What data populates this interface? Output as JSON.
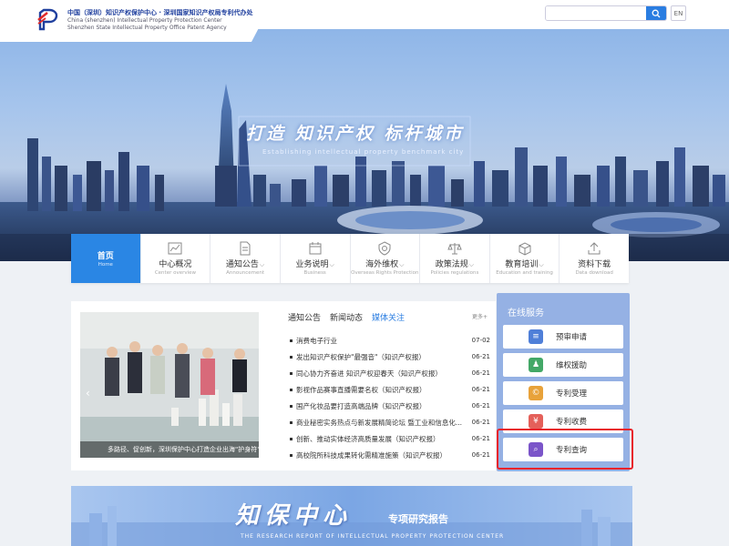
{
  "header": {
    "org_cn": "中国（深圳）知识产权保护中心 · 深圳国家知识产权局专利代办处",
    "org_en_1": "China (shenzhen) Intellectual Property Protection Center",
    "org_en_2": "Shenzhen State Intellectual Property Office Patent Agency",
    "search_placeholder": "",
    "lang_label": "EN"
  },
  "banner": {
    "slogan_cn": "打造 知识产权 标杆城市",
    "slogan_en": "Establishing intellectual property benchmark city"
  },
  "nav": [
    {
      "label": "首页",
      "sub": "Home",
      "icon": "home-icon",
      "active": true,
      "caret": ""
    },
    {
      "label": "中心概况",
      "sub": "Center overview",
      "icon": "chart-icon",
      "active": false,
      "caret": ""
    },
    {
      "label": "通知公告",
      "sub": "Announcement",
      "icon": "document-icon",
      "active": false,
      "caret": "⌵"
    },
    {
      "label": "业务说明",
      "sub": "Business",
      "icon": "calendar-icon",
      "active": false,
      "caret": "⌵"
    },
    {
      "label": "海外维权",
      "sub": "Overseas Rights Protection",
      "icon": "shield-icon",
      "active": false,
      "caret": "⌵"
    },
    {
      "label": "政策法规",
      "sub": "Policies regulations",
      "icon": "scale-icon",
      "active": false,
      "caret": "⌵"
    },
    {
      "label": "教育培训",
      "sub": "Education and training",
      "icon": "box-icon",
      "active": false,
      "caret": "⌵"
    },
    {
      "label": "资料下载",
      "sub": "Data download",
      "icon": "upload-icon",
      "active": false,
      "caret": ""
    }
  ],
  "news": {
    "tabs": [
      "通知公告",
      "新闻动态",
      "媒体关注"
    ],
    "active_tab": 2,
    "more_label": "更多+",
    "photo_caption": "多路径、促创新，深圳保护中心打造企业出海\"护身符\"",
    "items": [
      {
        "title": "消费电子行业",
        "date": "07-02"
      },
      {
        "title": "发出知识产权保护\"最强音\"（知识产权报）",
        "date": "06-21"
      },
      {
        "title": "同心协力齐奋进 知识产权迎春天（知识产权报）",
        "date": "06-21"
      },
      {
        "title": "影视作品赛事直播需要名权（知识产权报）",
        "date": "06-21"
      },
      {
        "title": "国产化妆品要打造高端品牌（知识产权报）",
        "date": "06-21"
      },
      {
        "title": "商业秘密实务热点与新发展精简论坛 暨工业和信息化...",
        "date": "06-21"
      },
      {
        "title": "创新、推动实体经济高质量发展（知识产权报）",
        "date": "06-21"
      },
      {
        "title": "高校院所科技成果转化需精准施策（知识产权报）",
        "date": "06-21"
      }
    ]
  },
  "services": {
    "title": "在线服务",
    "items": [
      {
        "label": "预审申请",
        "icon": "application-icon",
        "color": "#4f7fd8",
        "glyph": "≡"
      },
      {
        "label": "维权援助",
        "icon": "assistance-icon",
        "color": "#43a867",
        "glyph": "♟"
      },
      {
        "label": "专利受理",
        "icon": "copyright-icon",
        "color": "#e8a23a",
        "glyph": "©"
      },
      {
        "label": "专利收费",
        "icon": "fee-icon",
        "color": "#e4605a",
        "glyph": "¥"
      },
      {
        "label": "专利查询",
        "icon": "patent-search-icon",
        "color": "#7b55c9",
        "glyph": "⌕"
      }
    ],
    "highlight_color": "#e8222a"
  },
  "bottom_banner": {
    "title_cn": "知保中心",
    "subtitle_cn": "专项研究报告",
    "title_en": "THE RESEARCH REPORT OF INTELLECTUAL PROPERTY PROTECTION CENTER"
  },
  "colors": {
    "accent": "#2a86e4",
    "services_bg": "#95b1e4"
  }
}
